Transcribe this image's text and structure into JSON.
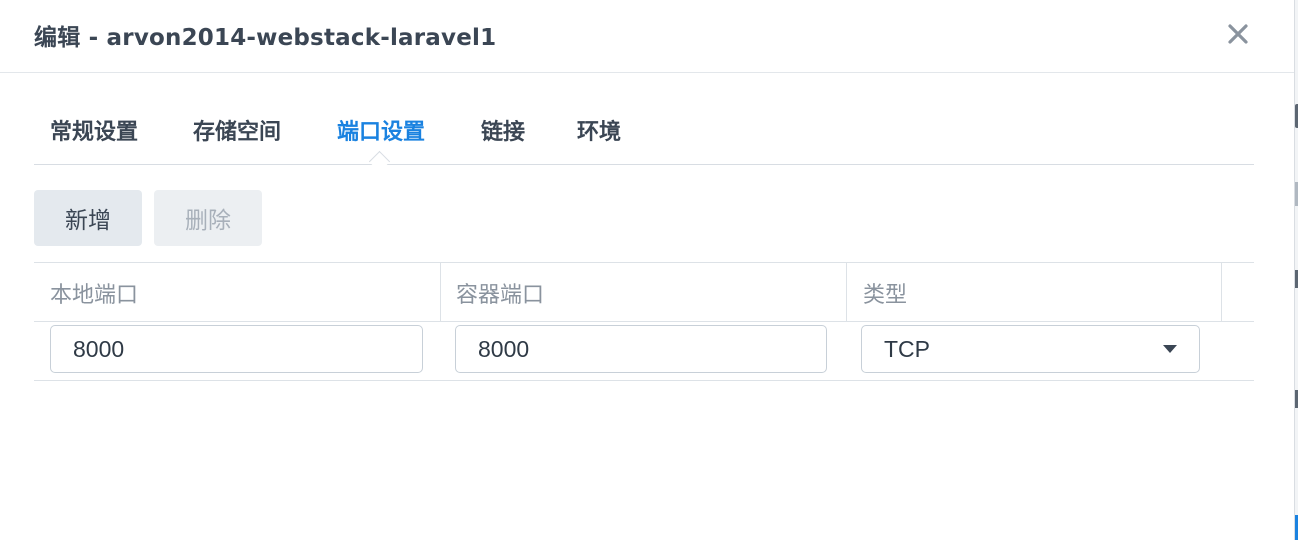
{
  "dialog": {
    "title": "编辑 - arvon2014-webstack-laravel1",
    "close_icon": "close-icon"
  },
  "tabs": [
    {
      "label": "常规设置",
      "active": false
    },
    {
      "label": "存储空间",
      "active": false
    },
    {
      "label": "端口设置",
      "active": true
    },
    {
      "label": "链接",
      "active": false
    },
    {
      "label": "环境",
      "active": false
    }
  ],
  "toolbar": {
    "add_label": "新增",
    "delete_label": "删除",
    "delete_disabled": true
  },
  "grid": {
    "columns": [
      "本地端口",
      "容器端口",
      "类型"
    ],
    "rows": [
      {
        "local_port": "8000",
        "container_port": "8000",
        "type": "TCP"
      }
    ]
  },
  "colors": {
    "accent": "#1a82e0",
    "text": "#3b4654",
    "muted": "#8a939e"
  }
}
